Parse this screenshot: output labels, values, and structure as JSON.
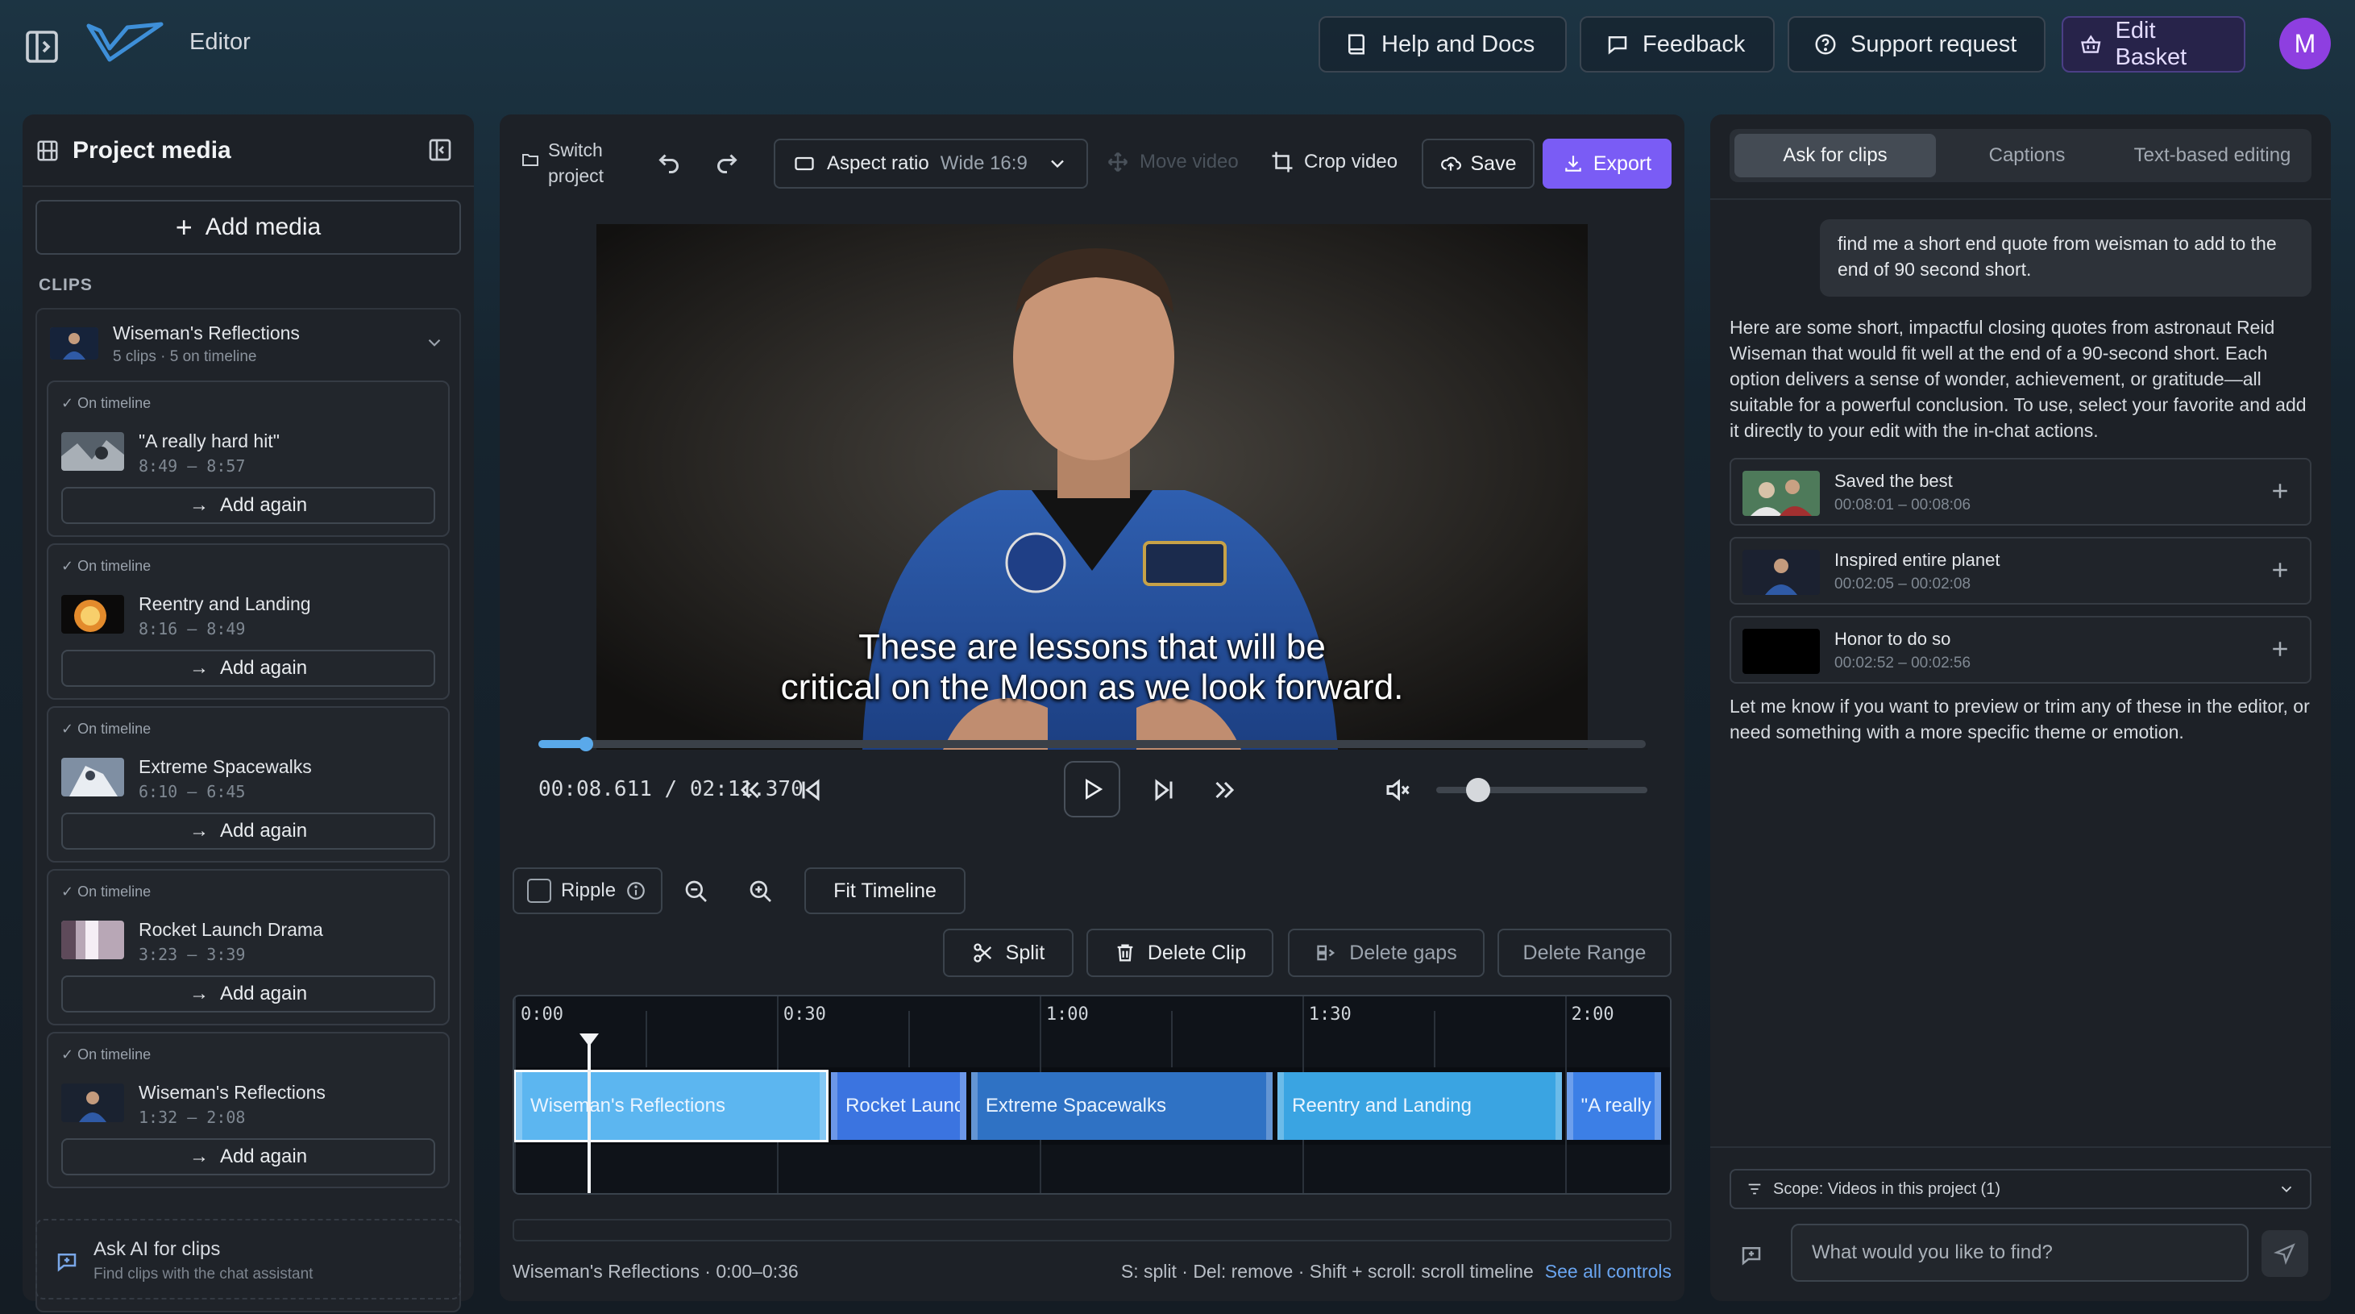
{
  "header": {
    "app_title": "Editor",
    "buttons": {
      "help": "Help and Docs",
      "feedback": "Feedback",
      "support": "Support request",
      "basket": "Edit Basket"
    },
    "avatar_initial": "M"
  },
  "media_panel": {
    "title": "Project media",
    "add_media": "Add media",
    "clips_label": "CLIPS",
    "group": {
      "name": "Wiseman's Reflections",
      "meta": "5 clips · 5 on timeline",
      "clips": [
        {
          "status": "On timeline",
          "name": "\"A really hard hit\"",
          "range": "8:49 – 8:57",
          "action": "Add again"
        },
        {
          "status": "On timeline",
          "name": "Reentry and Landing",
          "range": "8:16 – 8:49",
          "action": "Add again"
        },
        {
          "status": "On timeline",
          "name": "Extreme Spacewalks",
          "range": "6:10 – 6:45",
          "action": "Add again"
        },
        {
          "status": "On timeline",
          "name": "Rocket Launch Drama",
          "range": "3:23 – 3:39",
          "action": "Add again"
        },
        {
          "status": "On timeline",
          "name": "Wiseman's Reflections",
          "range": "1:32 – 2:08",
          "action": "Add again"
        }
      ]
    },
    "ask_ai": {
      "title": "Ask AI for clips",
      "subtitle": "Find clips with the chat assistant"
    }
  },
  "editor": {
    "switch_project": [
      "Switch",
      "project"
    ],
    "aspect": {
      "label": "Aspect ratio",
      "value": "Wide 16:9"
    },
    "move_video": "Move video",
    "crop_video": "Crop video",
    "save": "Save",
    "export": "Export",
    "subtitle_lines": [
      "These are lessons that will be",
      "critical on the Moon as we look forward."
    ],
    "timecode": "00:08.611 / 02:11.370",
    "progress": 0.043,
    "volume": 0.2,
    "ripple": "Ripple",
    "fit_timeline": "Fit Timeline",
    "edit_buttons": {
      "split": "Split",
      "delete_clip": "Delete Clip",
      "delete_gaps": "Delete gaps",
      "delete_range": "Delete Range"
    },
    "timeline": {
      "duration_seconds": 131.37,
      "visible_seconds": 132,
      "playhead_seconds": 8.6,
      "labels": [
        {
          "text": "0:00",
          "seconds": 0
        },
        {
          "text": "0:30",
          "seconds": 30
        },
        {
          "text": "1:00",
          "seconds": 60
        },
        {
          "text": "1:30",
          "seconds": 90
        },
        {
          "text": "2:00",
          "seconds": 120
        }
      ],
      "segments": [
        {
          "label": "Wiseman's Reflections",
          "start": 0,
          "end": 36,
          "color": "#5cb6f0",
          "selected": true
        },
        {
          "label": "Rocket Launch Drama",
          "start": 36,
          "end": 52,
          "color": "#3b74e0"
        },
        {
          "label": "Extreme Spacewalks",
          "start": 52,
          "end": 87,
          "color": "#2f72c4"
        },
        {
          "label": "Reentry and Landing",
          "start": 87,
          "end": 120,
          "color": "#3aa4e2"
        },
        {
          "label": "\"A really hard hit\"",
          "start": 120,
          "end": 131.37,
          "color": "#3c7fe6"
        }
      ]
    },
    "status": "Wiseman's Reflections · 0:00–0:36",
    "shortcuts": "S: split · Del: remove · Shift + scroll: scroll timeline",
    "see_all": "See all controls"
  },
  "assistant": {
    "tabs": [
      "Ask for clips",
      "Captions",
      "Text-based editing"
    ],
    "user_message": "find me a short end quote from weisman to add to the end of 90 second short.",
    "reply": "Here are some short, impactful closing quotes from astronaut Reid Wiseman that would fit well at the end of a 90-second short. Each option delivers a sense of wonder, achievement, or gratitude—all suitable for a powerful conclusion. To use, select your favorite and add it directly to your edit with the in-chat actions.",
    "suggestions": [
      {
        "title": "Saved the best",
        "range": "00:08:01 – 00:08:06"
      },
      {
        "title": "Inspired entire planet",
        "range": "00:02:05 – 00:02:08"
      },
      {
        "title": "Honor to do so",
        "range": "00:02:52 – 00:02:56"
      }
    ],
    "reply_2": "Let me know if you want to preview or trim any of these in the editor, or need something with a more specific theme or emotion.",
    "scope": "Scope: Videos in this project (1)",
    "input_placeholder": "What would you like to find?"
  }
}
